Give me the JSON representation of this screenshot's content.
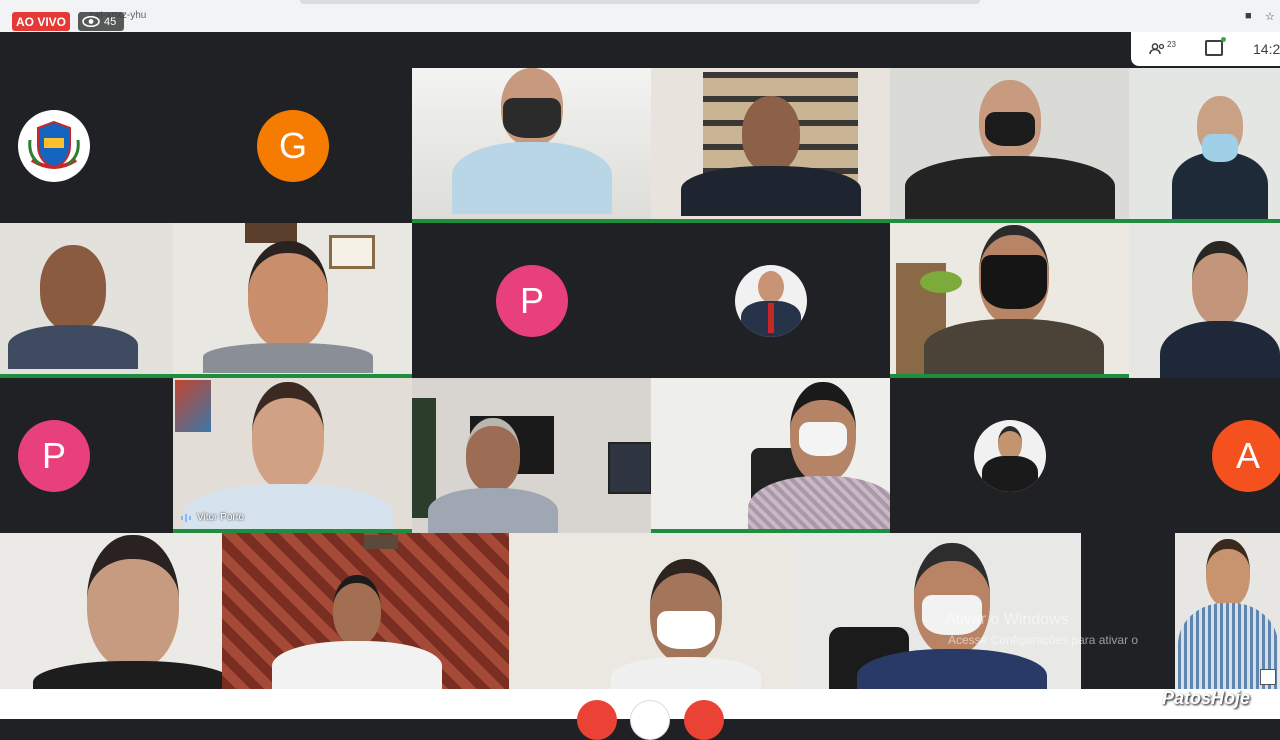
{
  "stream": {
    "live_label": "AO VIVO",
    "viewer_count": "45",
    "url_fragment": "zwt-xnxz-yhu"
  },
  "meet": {
    "participants_count": "23",
    "clock": "14:2",
    "activation_title": "Ativar o Windows",
    "activation_text": "Acesse Configurações para ativar o"
  },
  "tiles": {
    "g_letter": "G",
    "p1_letter": "P",
    "p2_letter": "P",
    "a_letter": "A",
    "vitor_name": "Vitor Porto"
  },
  "colors": {
    "live_red": "#e53935",
    "meet_green": "#1e8e3e",
    "avatar_orange": "#f57c00",
    "avatar_pink": "#e8407a",
    "avatar_orange_red": "#f4511e"
  },
  "branding": {
    "watermark": "PatosHoje"
  }
}
